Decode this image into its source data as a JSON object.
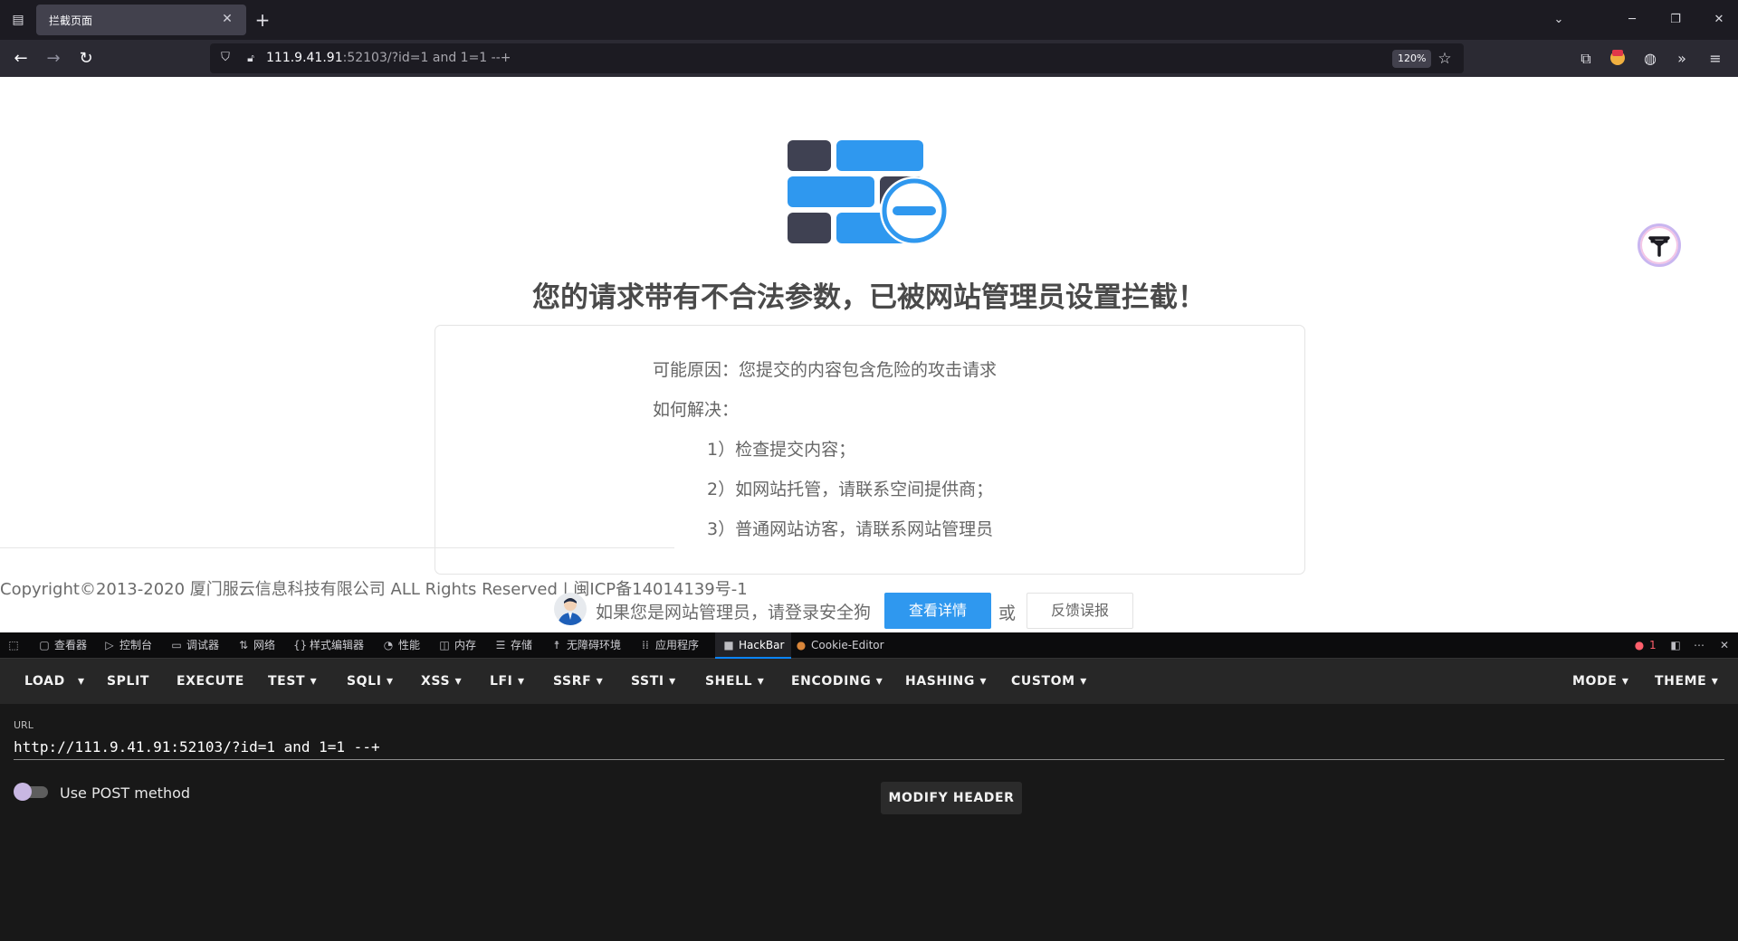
{
  "browser": {
    "tab_title": "拦截页面",
    "url_host": "111.9.41.91",
    "url_rest": ":52103/?id=1 and 1=1 --+",
    "zoom": "120%"
  },
  "page": {
    "headline": "您的请求带有不合法参数，已被网站管理员设置拦截！",
    "reason": "可能原因：您提交的内容包含危险的攻击请求",
    "how_to": "如何解决：",
    "steps": [
      "1）检查提交内容；",
      "2）如网站托管，请联系空间提供商；",
      "3）普通网站访客，请联系网站管理员"
    ],
    "copyright": "Copyright©2013-2020 厦门服云信息科技有限公司 ALL Rights Reserved | 闽ICP备14014139号-1",
    "admin_prompt": "如果您是网站管理员，请登录安全狗",
    "details_button": "查看详情",
    "or": "或",
    "feedback_button": "反馈误报",
    "colors": {
      "accent_blue": "#2f98ef",
      "dark_brick": "#3f4152"
    }
  },
  "devtools": {
    "tabs": [
      {
        "label": "查看器",
        "icon": "inspector-icon"
      },
      {
        "label": "控制台",
        "icon": "console-icon"
      },
      {
        "label": "调试器",
        "icon": "debugger-icon"
      },
      {
        "label": "网络",
        "icon": "network-icon"
      },
      {
        "label": "样式编辑器",
        "icon": "style-editor-icon"
      },
      {
        "label": "性能",
        "icon": "performance-icon"
      },
      {
        "label": "内存",
        "icon": "memory-icon"
      },
      {
        "label": "存储",
        "icon": "storage-icon"
      },
      {
        "label": "无障碍环境",
        "icon": "accessibility-icon"
      },
      {
        "label": "应用程序",
        "icon": "application-icon"
      },
      {
        "label": "HackBar",
        "icon": "hackbar-icon"
      },
      {
        "label": "Cookie-Editor",
        "icon": "cookie-icon"
      }
    ],
    "error_count": "1"
  },
  "hackbar": {
    "toolbar": {
      "load": "LOAD",
      "split": "SPLIT",
      "execute": "EXECUTE",
      "test": "TEST",
      "sqli": "SQLI",
      "xss": "XSS",
      "lfi": "LFI",
      "ssrf": "SSRF",
      "ssti": "SSTI",
      "shell": "SHELL",
      "encoding": "ENCODING",
      "hashing": "HASHING",
      "custom": "CUSTOM",
      "mode": "MODE",
      "theme": "THEME"
    },
    "url_label": "URL",
    "url_value": "http://111.9.41.91:52103/?id=1 and 1=1 --+",
    "post_label": "Use POST method",
    "modify_header": "MODIFY HEADER"
  }
}
